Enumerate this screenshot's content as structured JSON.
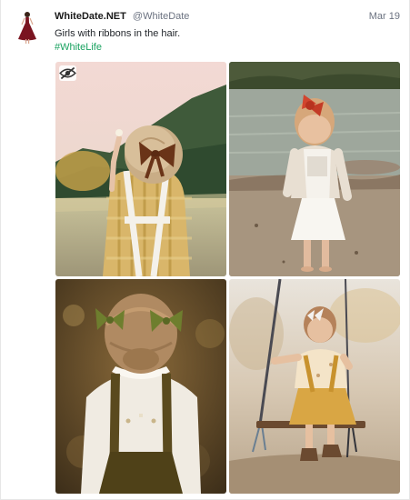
{
  "post": {
    "author_name": "WhiteDate.NET",
    "author_handle": "@WhiteDate",
    "date": "Mar 19",
    "text": "Girls with ribbons in the hair.",
    "hashtag": "#WhiteLife"
  },
  "avatar": {
    "icon": "woman-in-red-dress",
    "color": "#7a1420"
  },
  "media": {
    "items": [
      {
        "icon": "photo-girl-with-ribbon-meadow"
      },
      {
        "icon": "photo-girl-with-red-bow-lake"
      },
      {
        "icon": "photo-girl-with-green-bows"
      },
      {
        "icon": "photo-girl-on-swing"
      }
    ],
    "toggle_icon": "eye-slash-icon"
  },
  "colors": {
    "accent": "#1aa260",
    "muted": "#6b7280"
  }
}
